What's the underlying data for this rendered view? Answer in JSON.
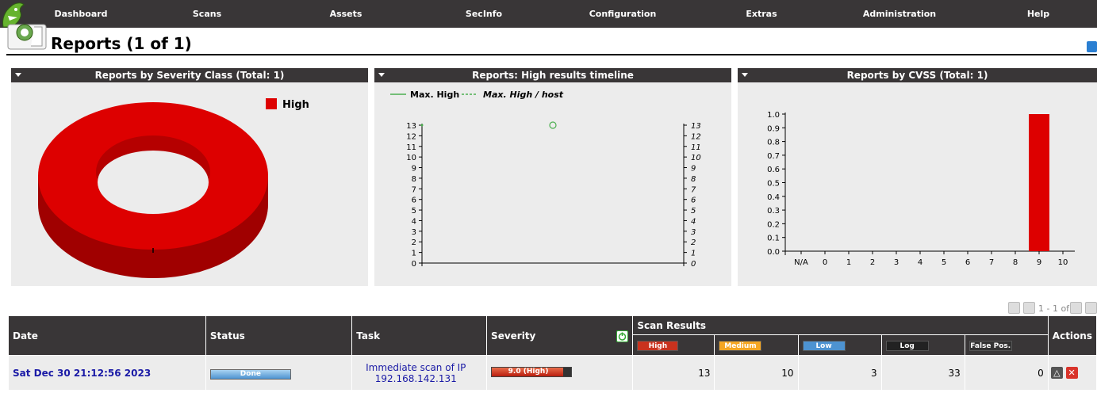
{
  "nav": {
    "items": [
      "Dashboard",
      "Scans",
      "Assets",
      "SecInfo",
      "Configuration",
      "Extras",
      "Administration",
      "Help"
    ]
  },
  "page": {
    "title": "Reports (1 of 1)"
  },
  "panels": {
    "severity": {
      "title": "Reports by Severity Class (Total: 1)",
      "legend": "High",
      "colors": {
        "top": "#dd0000",
        "side": "#a00000",
        "inner": "#b50000"
      }
    },
    "timeline": {
      "title": "Reports: High results timeline",
      "legend_max": "Max. High",
      "legend_host": "Max. High / host"
    },
    "cvss": {
      "title": "Reports by CVSS (Total: 1)"
    }
  },
  "chart_data": [
    {
      "type": "pie",
      "title": "Reports by Severity Class (Total: 1)",
      "categories": [
        "High"
      ],
      "values": [
        1
      ],
      "donut": true,
      "legend": "top-right"
    },
    {
      "type": "line",
      "title": "Reports: High results timeline",
      "series": [
        {
          "name": "Max. High",
          "values": [
            13
          ]
        },
        {
          "name": "Max. High / host",
          "values": [
            13
          ]
        }
      ],
      "ylim": [
        0,
        13
      ],
      "yticks": [
        0,
        1,
        2,
        3,
        4,
        5,
        6,
        7,
        8,
        9,
        10,
        11,
        12,
        13
      ],
      "legend": "top-left"
    },
    {
      "type": "bar",
      "title": "Reports by CVSS (Total: 1)",
      "categories": [
        "N/A",
        "0",
        "1",
        "2",
        "3",
        "4",
        "5",
        "6",
        "7",
        "8",
        "9",
        "10"
      ],
      "values": [
        0,
        0,
        0,
        0,
        0,
        0,
        0,
        0,
        0,
        0,
        1,
        0
      ],
      "ylim": [
        0,
        1.0
      ],
      "yticks": [
        "0.0",
        "0.1",
        "0.2",
        "0.3",
        "0.4",
        "0.5",
        "0.6",
        "0.7",
        "0.8",
        "0.9",
        "1.0"
      ],
      "color": "#dd0000"
    }
  ],
  "pager": {
    "text": "1 - 1 of 1"
  },
  "table": {
    "headers": {
      "date": "Date",
      "status": "Status",
      "task": "Task",
      "severity": "Severity",
      "scan_results": "Scan Results",
      "actions": "Actions"
    },
    "result_badges": {
      "high": "High",
      "medium": "Medium",
      "low": "Low",
      "log": "Log",
      "false_pos": "False Pos."
    },
    "badge_colors": {
      "high": "#c9321e",
      "medium": "#f5a623",
      "low": "#4d93d1",
      "log": "#222222",
      "false_pos": "#333333"
    },
    "rows": [
      {
        "date": "Sat Dec 30 21:12:56 2023",
        "status": "Done",
        "task": "Immediate scan of IP 192.168.142.131",
        "severity_label": "9.0 (High)",
        "severity_value": 9.0,
        "high": "13",
        "medium": "10",
        "low": "3",
        "log": "33",
        "false_pos": "0"
      }
    ]
  }
}
